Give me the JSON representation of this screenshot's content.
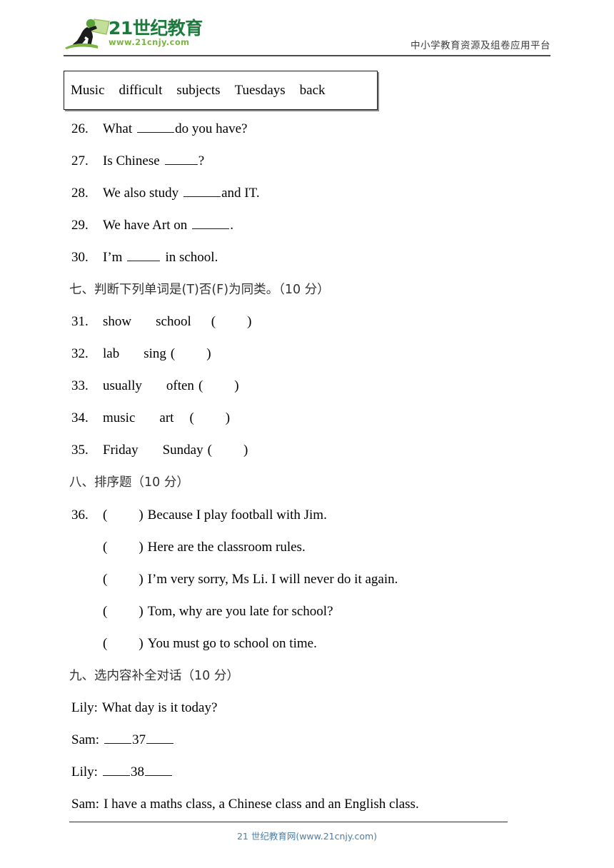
{
  "header": {
    "logo_main_text": "21世纪教育",
    "logo_url_text": "www.21cnjy.com",
    "logo_icon": "running-person-with-flag-icon",
    "tagline": "中小学教育资源及组卷应用平台",
    "brand_color_dark_green": "#1d7a3d",
    "brand_color_light_green": "#7cb342"
  },
  "word_bank": {
    "words": [
      "Music",
      "difficult",
      "subjects",
      "Tuesdays",
      "back"
    ]
  },
  "fill_in_questions": [
    {
      "num": "26.",
      "before": "What",
      "after": "do you have?"
    },
    {
      "num": "27.",
      "before": "Is Chinese",
      "after": "?"
    },
    {
      "num": "28.",
      "before": "We also study",
      "after": "and IT."
    },
    {
      "num": "29.",
      "before": "We have Art on",
      "after": "."
    },
    {
      "num": "30.",
      "before": "I’m",
      "after": "in school."
    }
  ],
  "section_seven": {
    "heading": "七、判断下列单词是(T)否(F)为同类。（10 分）",
    "items": [
      {
        "num": "31.",
        "word_a": "show",
        "word_b": "school"
      },
      {
        "num": "32.",
        "word_a": "lab",
        "word_b": "sing"
      },
      {
        "num": "33.",
        "word_a": "usually",
        "word_b": "often"
      },
      {
        "num": "34.",
        "word_a": "music",
        "word_b": "art"
      },
      {
        "num": "35.",
        "word_a": "Friday",
        "word_b": "Sunday"
      }
    ]
  },
  "section_eight": {
    "heading": "八、排序题（10 分）",
    "num": "36.",
    "sentences": [
      "Because I play football with Jim.",
      "Here are the classroom rules.",
      "I’m very sorry, Ms Li. I will never do it again.",
      "Tom, why are you late for school?",
      "You must go to school on time."
    ]
  },
  "section_nine": {
    "heading": "九、选内容补全对话（10 分）",
    "dialogue": [
      {
        "speaker": "Lily:",
        "text": "What day is it today?",
        "blank_number": ""
      },
      {
        "speaker": "Sam:",
        "text": "",
        "blank_number": "37"
      },
      {
        "speaker": "Lily:",
        "text": "",
        "blank_number": "38"
      },
      {
        "speaker": "Sam:",
        "text": "I have a maths class, a Chinese class and an English class.",
        "blank_number": ""
      }
    ]
  },
  "footer": {
    "text": "21 世纪教育网(www.21cnjy.com)",
    "color": "#4a7ea8"
  }
}
